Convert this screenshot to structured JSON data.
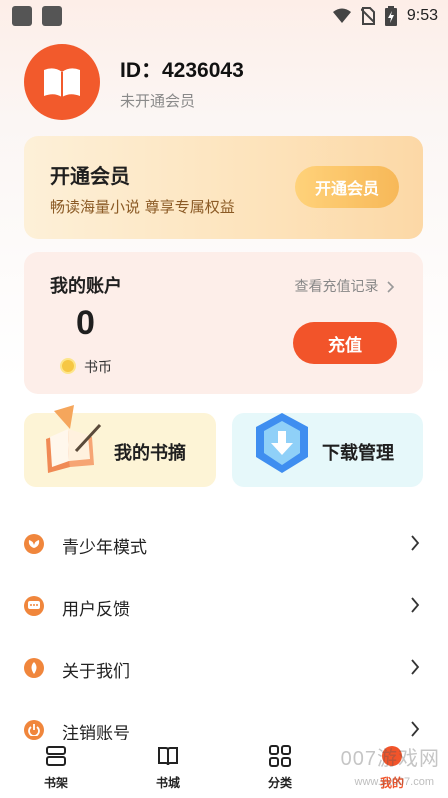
{
  "status_bar": {
    "time": "9:53"
  },
  "profile": {
    "id_text": "ID：4236043",
    "vip_status": "未开通会员"
  },
  "vip_card": {
    "title": "开通会员",
    "subtitle": "畅读海量小说 尊享专属权益",
    "button": "开通会员"
  },
  "account": {
    "title": "我的账户",
    "records_link": "查看充值记录",
    "balance": "0",
    "currency": "书币",
    "recharge_button": "充值"
  },
  "shortcuts": [
    {
      "label": "我的书摘"
    },
    {
      "label": "下载管理"
    }
  ],
  "menu": [
    {
      "label": "青少年模式",
      "icon": "teen-mode-icon"
    },
    {
      "label": "用户反馈",
      "icon": "feedback-icon"
    },
    {
      "label": "关于我们",
      "icon": "about-icon"
    },
    {
      "label": "注销账号",
      "icon": "logout-icon"
    }
  ],
  "tabbar": [
    {
      "label": "书架",
      "icon": "bookshelf-icon"
    },
    {
      "label": "书城",
      "icon": "bookstore-icon"
    },
    {
      "label": "分类",
      "icon": "category-icon"
    },
    {
      "label": "我的",
      "icon": "profile-icon"
    }
  ],
  "watermark": {
    "brand": "007游戏网",
    "url": "www.yx007.com"
  },
  "colors": {
    "accent": "#f2542a",
    "vip_gold": "#f7b858",
    "menu_icon": "#f0863c"
  }
}
